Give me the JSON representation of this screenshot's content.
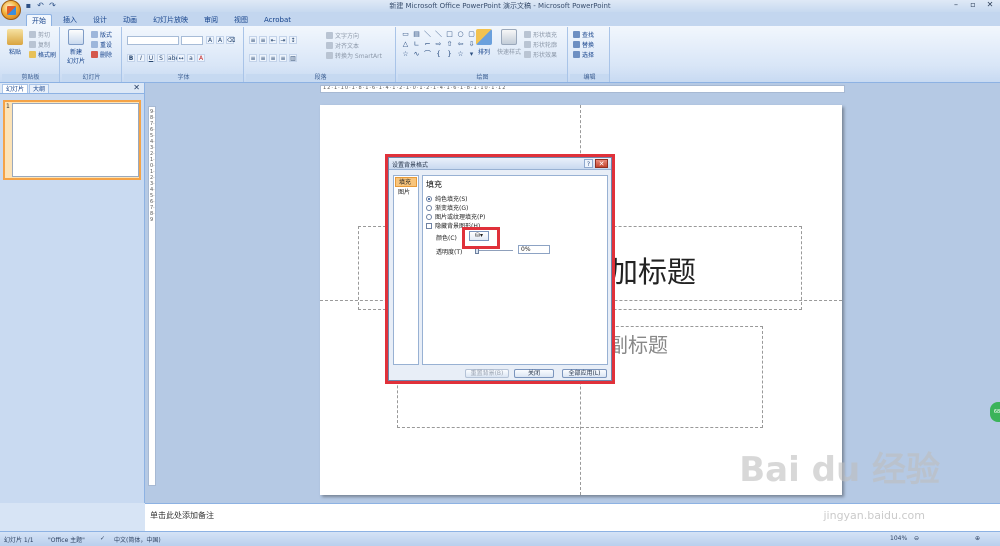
{
  "window": {
    "title": "新建 Microsoft Office PowerPoint 演示文稿 - Microsoft PowerPoint",
    "qat_icons": [
      "save-icon",
      "undo-icon",
      "redo-icon"
    ]
  },
  "tabs": [
    "开始",
    "插入",
    "设计",
    "动画",
    "幻灯片放映",
    "审阅",
    "视图",
    "Acrobat"
  ],
  "ribbon": {
    "clipboard": {
      "paste": "粘贴",
      "cut": "剪切",
      "copy": "复制",
      "format_painter": "格式刷",
      "label": "剪贴板"
    },
    "slides": {
      "new_slide_line1": "新建",
      "new_slide_line2": "幻灯片",
      "layout": "版式",
      "reset": "重设",
      "delete": "删除",
      "label": "幻灯片"
    },
    "font": {
      "label": "字体",
      "bold": "B",
      "italic": "I",
      "underline": "U",
      "strike": "S",
      "shadow": "abe",
      "grow": "A",
      "shrink": "A"
    },
    "paragraph": {
      "label": "段落",
      "text_direction": "文字方向",
      "align_text": "对齐文本",
      "convert_smartart": "转换为 SmartArt"
    },
    "drawing": {
      "label": "绘图",
      "arrange": "排列",
      "quick_styles": "快速样式",
      "shape_fill": "形状填充",
      "shape_outline": "形状轮廓",
      "shape_effects": "形状效果"
    },
    "editing": {
      "label": "编辑",
      "find": "查找",
      "replace": "替换",
      "select": "选择"
    }
  },
  "left_pane": {
    "tab_slides": "幻灯片",
    "tab_outline": "大纲",
    "slide_number": "1"
  },
  "slide": {
    "title_placeholder": "加标题",
    "subtitle_placeholder": "副标题"
  },
  "rulers": {
    "horizontal": "12·1·10·1·8·1·6·1·4·1·2·1·0·1·2·1·4·1·6·1·8·1·10·1·12",
    "vertical": "9·8·7·6·5·4·3·2·1·0·1·2·3·4·5·6·7·8·9"
  },
  "notes": {
    "placeholder": "单击此处添加备注"
  },
  "status": {
    "slide_info": "幻灯片 1/1",
    "theme": "\"Office 主题\"",
    "language": "中文(简体，中国)",
    "zoom": "104%"
  },
  "dialog": {
    "title": "设置背景格式",
    "nav": [
      "填充",
      "图片"
    ],
    "section": "填充",
    "options": {
      "solid_fill": "纯色填充(S)",
      "gradient_fill": "渐变填充(G)",
      "picture_fill": "图片或纹理填充(P)",
      "hide_graphics": "隐藏背景图形(H)"
    },
    "color_label": "颜色(C)",
    "transparency_label": "透明度(T)",
    "transparency_value": "0%",
    "buttons": {
      "reset": "重置背景(B)",
      "close": "关闭",
      "apply_all": "全部应用(L)"
    }
  },
  "watermark": {
    "text": "Bai du 经验",
    "url": "jingyan.baidu.com"
  },
  "side_badge": "68"
}
